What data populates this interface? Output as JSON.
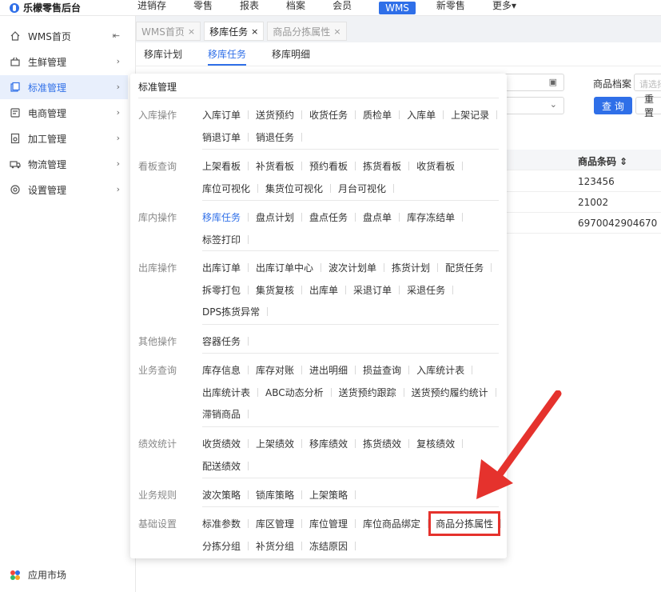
{
  "topbar": {
    "logo": "乐檬零售后台",
    "nav": [
      "进销存",
      "零售",
      "报表",
      "档案",
      "会员",
      "WMS",
      "新零售",
      "更多▾"
    ],
    "active": "WMS"
  },
  "sidebar": {
    "items": [
      {
        "label": "WMS首页",
        "icon": "home-icon",
        "suffix": "collapse-icon"
      },
      {
        "label": "生鲜管理",
        "icon": "basket-icon"
      },
      {
        "label": "标准管理",
        "icon": "standard-icon",
        "active": true
      },
      {
        "label": "电商管理",
        "icon": "cart-icon"
      },
      {
        "label": "加工管理",
        "icon": "process-icon"
      },
      {
        "label": "物流管理",
        "icon": "truck-icon"
      },
      {
        "label": "设置管理",
        "icon": "gear-icon"
      }
    ],
    "app_market": "应用市场"
  },
  "tabs": [
    {
      "label": "WMS首页"
    },
    {
      "label": "移库任务",
      "active": true
    },
    {
      "label": "商品分拣属性"
    }
  ],
  "subtabs": [
    "移库计划",
    "移库任务",
    "移库明细"
  ],
  "filters": {
    "product_label": "商品档案",
    "product_placeholder": "请选择",
    "query": "查 询",
    "reset": "重 置"
  },
  "table": {
    "column": "商品条码 ⇕",
    "rows": [
      "123456",
      "21002",
      "6970042904670"
    ]
  },
  "menu": {
    "title": "标准管理",
    "groups": [
      {
        "name": "入库操作",
        "rows": [
          [
            "入库订单",
            "送货预约",
            "收货任务",
            "质检单",
            "入库单",
            "上架记录"
          ],
          [
            "销退订单",
            "销退任务"
          ]
        ]
      },
      {
        "name": "看板查询",
        "rows": [
          [
            "上架看板",
            "补货看板",
            "预约看板",
            "拣货看板",
            "收货看板"
          ],
          [
            "库位可视化",
            "集货位可视化",
            "月台可视化"
          ]
        ]
      },
      {
        "name": "库内操作",
        "rows": [
          [
            "移库任务",
            "盘点计划",
            "盘点任务",
            "盘点单",
            "库存冻结单"
          ],
          [
            "标签打印"
          ]
        ]
      },
      {
        "name": "出库操作",
        "rows": [
          [
            "出库订单",
            "出库订单中心",
            "波次计划单",
            "拣货计划",
            "配货任务"
          ],
          [
            "拆零打包",
            "集货复核",
            "出库单",
            "采退订单",
            "采退任务"
          ],
          [
            "DPS拣货异常"
          ]
        ]
      },
      {
        "name": "其他操作",
        "rows": [
          [
            "容器任务"
          ]
        ]
      },
      {
        "name": "业务查询",
        "rows": [
          [
            "库存信息",
            "库存对账",
            "进出明细",
            "损益查询",
            "入库统计表"
          ],
          [
            "出库统计表",
            "ABC动态分析",
            "送货预约跟踪",
            "送货预约履约统计"
          ],
          [
            "滞销商品"
          ]
        ]
      },
      {
        "name": "绩效统计",
        "rows": [
          [
            "收货绩效",
            "上架绩效",
            "移库绩效",
            "拣货绩效",
            "复核绩效"
          ],
          [
            "配送绩效"
          ]
        ]
      },
      {
        "name": "业务规则",
        "rows": [
          [
            "波次策略",
            "锁库策略",
            "上架策略"
          ]
        ]
      },
      {
        "name": "基础设置",
        "rows": [
          [
            "标准参数",
            "库区管理",
            "库位管理",
            "库位商品绑定",
            "商品分拣属性"
          ],
          [
            "分拣分组",
            "补货分组",
            "冻结原因"
          ]
        ]
      }
    ],
    "current_item": "移库任务",
    "highlighted_item": "商品分拣属性"
  },
  "colors": {
    "accent": "#2f6fe8",
    "highlight": "#e5322d"
  }
}
